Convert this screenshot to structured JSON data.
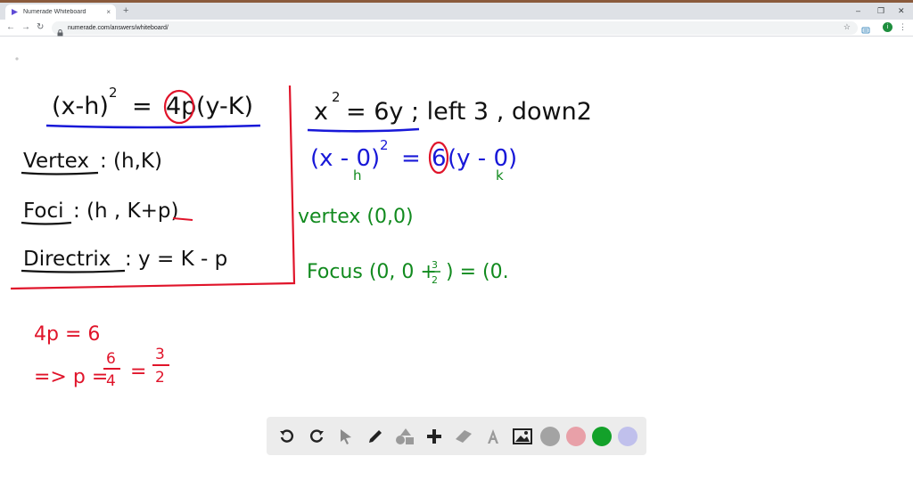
{
  "browser": {
    "tab_title": "Numerade Whiteboard",
    "tab_close": "×",
    "new_tab": "+",
    "url": "numerade.com/answers/whiteboard/",
    "window_controls": {
      "minimize": "–",
      "restore": "❐",
      "close": "✕"
    },
    "back": "←",
    "forward": "→",
    "reload": "↻",
    "star": "☆",
    "profile_initial": "i",
    "menu": "⋮"
  },
  "whiteboard": {
    "formula_box": {
      "equation": [
        "(x-h)",
        "2",
        "=",
        "4p",
        "(y-K)"
      ],
      "vertex_label": "Vertex",
      "vertex_value": ": (h,K)",
      "foci_label": "Foci",
      "foci_value": ": (h , K+p)",
      "directrix_label": "Directrix",
      "directrix_value": ": y = K - p"
    },
    "problem": {
      "equation_parts": [
        "x",
        "2",
        "= 6y ; left 3 , down2"
      ],
      "standard_form": [
        "(x - 0)",
        "2",
        "=",
        "6",
        "(y - 0)"
      ],
      "h_label": "h",
      "k_label": "k",
      "vertex_line": "vertex (0,0)",
      "focus_line_start": "Focus (0, 0 +",
      "focus_fraction_num": "3",
      "focus_fraction_den": "2",
      "focus_line_end": ") = (0."
    },
    "work": {
      "line1": "4p = 6",
      "line2_start": "=> p =",
      "frac1_num": "6",
      "frac1_den": "4",
      "equals": "=",
      "frac2_num": "3",
      "frac2_den": "2"
    },
    "colors": {
      "black": "#111111",
      "red": "#e0142a",
      "blue": "#1818d8",
      "green": "#118a1e"
    }
  },
  "toolbar_tools": [
    {
      "name": "undo-icon",
      "glyph": "↶"
    },
    {
      "name": "redo-icon",
      "glyph": "↷"
    },
    {
      "name": "select-icon",
      "glyph": "➤"
    },
    {
      "name": "pen-icon",
      "glyph": "✎"
    },
    {
      "name": "shapes-icon",
      "glyph": "▲"
    },
    {
      "name": "add-icon",
      "glyph": "+"
    },
    {
      "name": "eraser-icon",
      "glyph": "▱"
    },
    {
      "name": "text-icon",
      "glyph": "A"
    },
    {
      "name": "image-icon",
      "glyph": "▣"
    }
  ],
  "swatches": [
    {
      "name": "swatch-gray",
      "color": "#a3a3a3"
    },
    {
      "name": "swatch-pink",
      "color": "#e8a0a8"
    },
    {
      "name": "swatch-green",
      "color": "#13a12a"
    },
    {
      "name": "swatch-lavender",
      "color": "#c0c0ec"
    }
  ]
}
